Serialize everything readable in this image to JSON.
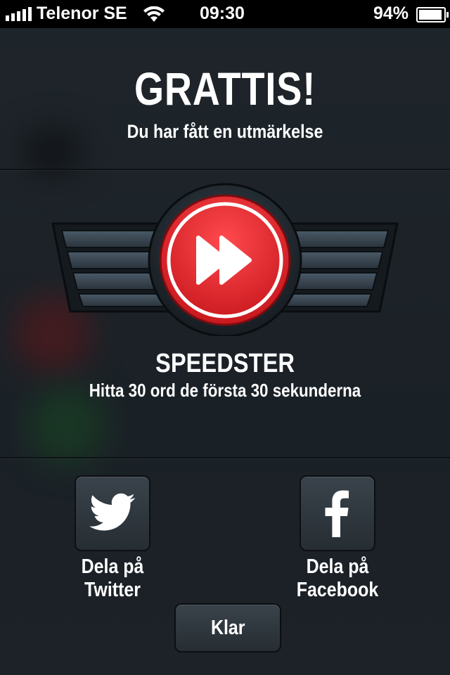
{
  "status_bar": {
    "carrier": "Telenor SE",
    "time": "09:30",
    "battery_percent": "94%",
    "signal_bars": 5,
    "battery_level": 0.94
  },
  "dialog": {
    "title": "GRATTIS!",
    "subtitle": "Du har fått en utmärkelse",
    "award": {
      "name": "SPEEDSTER",
      "description": "Hitta 30 ord de första 30 sekunderna",
      "icon": "fast-forward-icon",
      "badge_color": "#e8262c"
    },
    "share": {
      "twitter_label": "Dela på Twitter",
      "facebook_label": "Dela på Facebook"
    },
    "done_label": "Klar"
  }
}
